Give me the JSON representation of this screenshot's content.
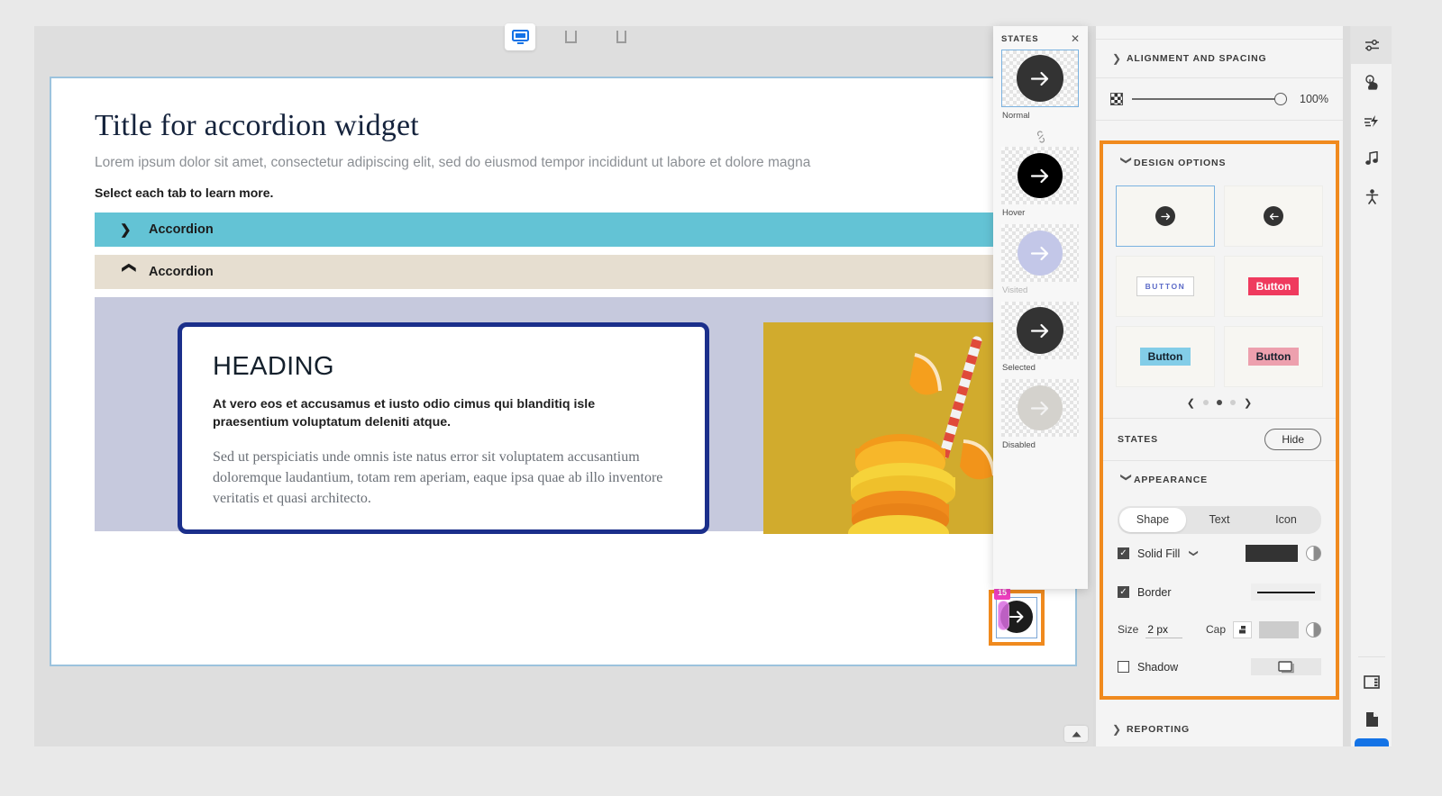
{
  "toolbar": {
    "devices": [
      {
        "name": "desktop-preview",
        "icon": "monitor-icon",
        "active": true
      },
      {
        "name": "tablet-preview",
        "icon": "tablet-icon",
        "active": false
      },
      {
        "name": "mobile-preview",
        "icon": "phone-icon",
        "active": false
      }
    ]
  },
  "canvas": {
    "title": "Title for accordion widget",
    "subtitle": "Lorem ipsum dolor sit amet, consectetur adipiscing elit, sed do eiusmod tempor incididunt ut labore et dolore magna",
    "hint": "Select each tab to learn more.",
    "accordions": [
      {
        "label": "Accordion",
        "state": "collapsed",
        "chevron": "chevron-right-icon",
        "color": "#63c3d5"
      },
      {
        "label": "Accordion",
        "state": "expanded",
        "chevron": "chevron-down-icon",
        "color": "#e6ded0"
      }
    ],
    "card": {
      "heading": "HEADING",
      "lead": "At vero eos et accusamus et iusto odio cimus qui blanditiq isle praesentium voluptatum deleniti atque.",
      "body": "Sed ut perspiciatis unde omnis iste natus error sit voluptatem accusantium doloremque laudantium, totam rem aperiam, eaque ipsa quae ab illo inventore veritatis et quasi architecto.",
      "border_color": "#1b2f8b"
    },
    "image_alt": "stacked orange and lemon slices with red striped straw on yellow background",
    "nav": {
      "prev_icon": "arrow-left-icon",
      "next_icon": "arrow-right-icon",
      "selection_badge": "15"
    }
  },
  "states_panel": {
    "title": "STATES",
    "close_icon": "close-icon",
    "items": [
      {
        "label": "Normal",
        "selected": true,
        "fill": "#333333",
        "arrow": "arrow-right-icon",
        "dim": false
      },
      {
        "label": "Hover",
        "selected": false,
        "fill": "#000000",
        "arrow": "arrow-right-icon",
        "dim": false
      },
      {
        "label": "Visited",
        "selected": false,
        "fill": "#c3c7e8",
        "arrow": "arrow-right-icon",
        "dim": true
      },
      {
        "label": "Selected",
        "selected": false,
        "fill": "#333333",
        "arrow": "arrow-right-icon",
        "dim": false
      },
      {
        "label": "Disabled",
        "selected": false,
        "fill": "#d4d2cd",
        "arrow": "arrow-right-icon",
        "dim": false
      }
    ],
    "link_icon": "link-icon"
  },
  "properties": {
    "alignment_section": {
      "title": "ALIGNMENT AND SPACING",
      "chevron": "chevron-right-icon",
      "expanded": false
    },
    "opacity": {
      "icon": "checkerboard-icon",
      "value": "100%",
      "slider_percent": 100
    },
    "design_options": {
      "title": "DESIGN OPTIONS",
      "chevron": "chevron-down-icon",
      "expanded": true,
      "options": [
        {
          "name": "arrow-right-circle-option",
          "label": "",
          "selected": true,
          "kind": "circle-arrow-right"
        },
        {
          "name": "arrow-left-circle-option",
          "label": "",
          "selected": false,
          "kind": "circle-arrow-left"
        },
        {
          "name": "outline-button-option",
          "label": "BUTTON",
          "selected": false,
          "kind": "outline"
        },
        {
          "name": "pink-button-option",
          "label": "Button",
          "selected": false,
          "kind": "pink"
        },
        {
          "name": "blue-button-option",
          "label": "Button",
          "selected": false,
          "kind": "blue"
        },
        {
          "name": "rose-button-option",
          "label": "Button",
          "selected": false,
          "kind": "rose"
        }
      ],
      "pager": {
        "prev_icon": "chevron-left-icon",
        "next_icon": "chevron-right-icon",
        "dots": 3,
        "active_dot": 2
      }
    },
    "states_row": {
      "label": "STATES",
      "button": "Hide"
    },
    "appearance": {
      "title": "APPEARANCE",
      "chevron": "chevron-down-icon",
      "tabs": [
        {
          "label": "Shape",
          "active": true
        },
        {
          "label": "Text",
          "active": false
        },
        {
          "label": "Icon",
          "active": false
        }
      ],
      "solid_fill": {
        "label": "Solid Fill",
        "checked": true,
        "dropdown_icon": "chevron-down-icon",
        "color": "#333333"
      },
      "border": {
        "label": "Border",
        "checked": true,
        "color": "#cccccc",
        "size_label": "Size",
        "size_value": "2 px",
        "cap_label": "Cap",
        "cap_icon": "line-cap-icon"
      },
      "shadow": {
        "label": "Shadow",
        "checked": false,
        "preview_icon": "shadow-box-icon"
      }
    },
    "reporting_section": {
      "title": "REPORTING",
      "chevron": "chevron-right-icon",
      "expanded": false
    }
  },
  "rail": {
    "icons": [
      {
        "name": "properties-sliders-icon",
        "active": true
      },
      {
        "name": "interactions-hand-icon",
        "active": false
      },
      {
        "name": "animation-bolt-icon",
        "active": false
      },
      {
        "name": "audio-note-icon",
        "active": false
      },
      {
        "name": "accessibility-person-icon",
        "active": false
      }
    ],
    "bottom_icons": [
      {
        "name": "layout-window-icon",
        "active": false
      },
      {
        "name": "page-document-icon",
        "active": false
      }
    ]
  }
}
